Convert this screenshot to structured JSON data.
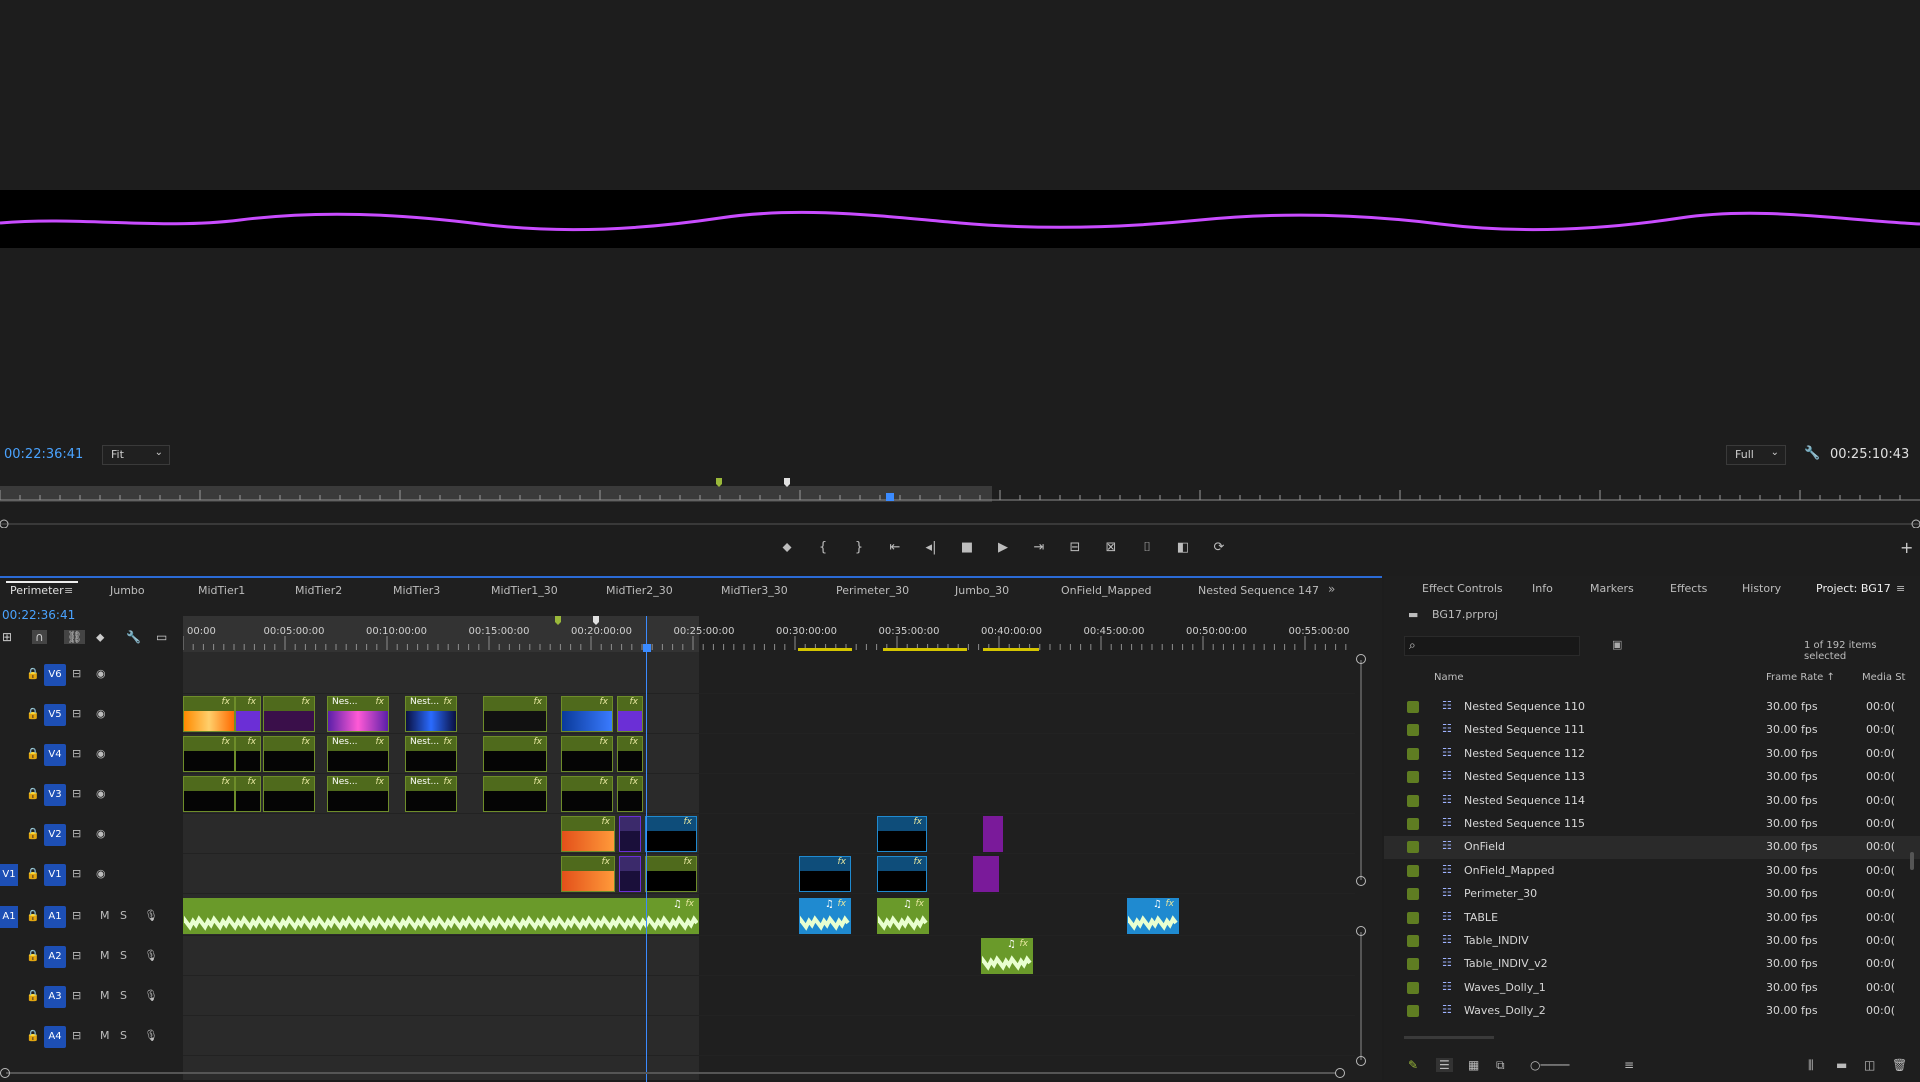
{
  "source_monitor": {
    "timecode_left": "00:22:36:41",
    "zoom_label": "Fit",
    "resolution_label": "Full",
    "timecode_right": "00:25:10:43"
  },
  "timeline": {
    "sequence_tabs": [
      "Perimeter",
      "Jumbo",
      "MidTier1",
      "MidTier2",
      "MidTier3",
      "MidTier1_30",
      "MidTier2_30",
      "MidTier3_30",
      "Perimeter_30",
      "Jumbo_30",
      "OnField_Mapped",
      "Nested Sequence 147"
    ],
    "playhead_timecode": "00:22:36:41",
    "ruler_ticks": [
      "00:00",
      "00:05:00:00",
      "00:10:00:00",
      "00:15:00:00",
      "00:20:00:00",
      "00:25:00:00",
      "00:30:00:00",
      "00:35:00:00",
      "00:40:00:00",
      "00:45:00:00",
      "00:50:00:00",
      "00:55:00:00"
    ],
    "video_tracks": [
      "V6",
      "V5",
      "V4",
      "V3",
      "V2",
      "V1"
    ],
    "audio_tracks": [
      "A1",
      "A2",
      "A3",
      "A4"
    ],
    "source_v": "V1",
    "source_a": "A1",
    "mute_label": "M",
    "solo_label": "S",
    "clip_fx_label": "fx",
    "nest_label_short": "Nes...",
    "nest_label_mid": "Nest..."
  },
  "project": {
    "tabs": [
      "Effect Controls",
      "Info",
      "Markers",
      "Effects",
      "History",
      "Project: BG17"
    ],
    "file_name": "BG17.prproj",
    "selection_status": "1 of 192 items selected",
    "columns": {
      "name": "Name",
      "frame_rate": "Frame Rate",
      "media_start": "Media St"
    },
    "items": [
      {
        "name": "Nested Sequence 110",
        "fps": "30.00 fps",
        "media": "00:0("
      },
      {
        "name": "Nested Sequence 111",
        "fps": "30.00 fps",
        "media": "00:0("
      },
      {
        "name": "Nested Sequence 112",
        "fps": "30.00 fps",
        "media": "00:0("
      },
      {
        "name": "Nested Sequence 113",
        "fps": "30.00 fps",
        "media": "00:0("
      },
      {
        "name": "Nested Sequence 114",
        "fps": "30.00 fps",
        "media": "00:0("
      },
      {
        "name": "Nested Sequence 115",
        "fps": "30.00 fps",
        "media": "00:0("
      },
      {
        "name": "OnField",
        "fps": "30.00 fps",
        "media": "00:0("
      },
      {
        "name": "OnField_Mapped",
        "fps": "30.00 fps",
        "media": "00:0("
      },
      {
        "name": "Perimeter_30",
        "fps": "30.00 fps",
        "media": "00:0("
      },
      {
        "name": "TABLE",
        "fps": "30.00 fps",
        "media": "00:0("
      },
      {
        "name": "Table_INDIV",
        "fps": "30.00 fps",
        "media": "00:0("
      },
      {
        "name": "Table_INDIV_v2",
        "fps": "30.00 fps",
        "media": "00:0("
      },
      {
        "name": "Waves_Dolly_1",
        "fps": "30.00 fps",
        "media": "00:0("
      },
      {
        "name": "Waves_Dolly_2",
        "fps": "30.00 fps",
        "media": "00:0("
      }
    ]
  },
  "colors": {
    "accent": "#2b6bd6",
    "clip_green": "#4f6a1c",
    "audio_green": "#8fbf3a",
    "nest_purple": "#6b2fd6"
  }
}
